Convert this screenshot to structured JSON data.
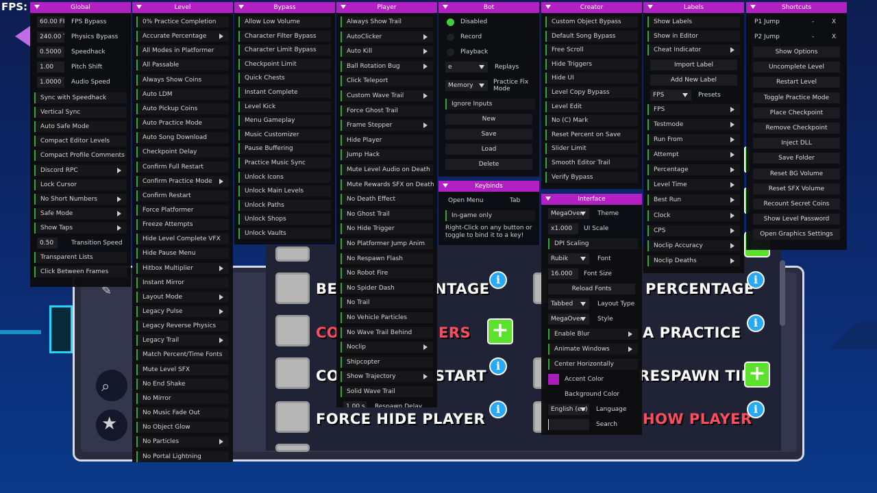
{
  "overlay": {
    "fps_label": "FPS:"
  },
  "game": {
    "rows": [
      {
        "left": "BE",
        "right": "NTAGE",
        "left_red": false,
        "right_red": false,
        "left_icon": "info",
        "right_text": "PERCENTAGE",
        "right_red2": false,
        "right_icon": "info"
      },
      {
        "left": "CO",
        "right": "ERS",
        "left_red": true,
        "right_red": true,
        "left_icon": "plus",
        "right_text": "A PRACTICE",
        "right_red2": false,
        "right_icon": "info"
      },
      {
        "left": "CO",
        "right": "START",
        "left_red": false,
        "right_red": false,
        "left_icon": "info",
        "right_text": "RESPAWN TIME",
        "right_red2": false,
        "right_icon": "plus"
      },
      {
        "left": "FORCE HIDE PLAYER",
        "right": "",
        "left_red": false,
        "right_red": false,
        "left_icon": "info",
        "right_text": "HOW PLAYER",
        "right_red2": true,
        "right_icon": "info"
      }
    ],
    "top_right_text": "...",
    "search_icon": "search-icon",
    "star_icon": "star-icon"
  },
  "panels": {
    "global": {
      "title": "Global",
      "inputs": [
        {
          "value": "60.00 FPS",
          "label": "FPS Bypass"
        },
        {
          "value": "240.00 TPS",
          "label": "Physics Bypass"
        },
        {
          "value": "0.5000",
          "label": "Speedhack"
        },
        {
          "value": "1.00",
          "label": "Pitch Shift"
        },
        {
          "value": "1.0000",
          "label": "Audio Speed"
        }
      ],
      "mods": [
        {
          "label": "Sync with Speedhack",
          "sub": false
        },
        {
          "label": "Vertical Sync",
          "sub": false
        },
        {
          "label": "Auto Safe Mode",
          "sub": false
        },
        {
          "label": "Compact Editor Levels",
          "sub": false
        },
        {
          "label": "Compact Profile Comments",
          "sub": false
        },
        {
          "label": "Discord RPC",
          "sub": true
        },
        {
          "label": "Lock Cursor",
          "sub": false
        },
        {
          "label": "No Short Numbers",
          "sub": true
        },
        {
          "label": "Safe Mode",
          "sub": true
        },
        {
          "label": "Show Taps",
          "sub": true
        }
      ],
      "transition": {
        "value": "0.50",
        "label": "Transition Speed"
      },
      "mods2": [
        {
          "label": "Transparent Lists",
          "sub": false
        },
        {
          "label": "Click Between Frames",
          "sub": false
        }
      ]
    },
    "level": {
      "title": "Level",
      "mods": [
        {
          "label": "0% Practice Completion",
          "sub": false
        },
        {
          "label": "Accurate Percentage",
          "sub": true
        },
        {
          "label": "All Modes in Platformer",
          "sub": false
        },
        {
          "label": "All Passable",
          "sub": false
        },
        {
          "label": "Always Show Coins",
          "sub": false
        },
        {
          "label": "Auto LDM",
          "sub": false
        },
        {
          "label": "Auto Pickup Coins",
          "sub": false
        },
        {
          "label": "Auto Practice Mode",
          "sub": false
        },
        {
          "label": "Auto Song Download",
          "sub": false
        },
        {
          "label": "Checkpoint Delay",
          "sub": false
        },
        {
          "label": "Confirm Full Restart",
          "sub": false
        },
        {
          "label": "Confirm Practice Mode",
          "sub": true
        },
        {
          "label": "Confirm Restart",
          "sub": false
        },
        {
          "label": "Force Platformer",
          "sub": false
        },
        {
          "label": "Freeze Attempts",
          "sub": false
        },
        {
          "label": "Hide Level Complete VFX",
          "sub": false
        },
        {
          "label": "Hide Pause Menu",
          "sub": false
        },
        {
          "label": "Hitbox Multiplier",
          "sub": true
        },
        {
          "label": "Instant Mirror",
          "sub": false
        },
        {
          "label": "Layout Mode",
          "sub": true
        },
        {
          "label": "Legacy Pulse",
          "sub": true
        },
        {
          "label": "Legacy Reverse Physics",
          "sub": false
        },
        {
          "label": "Legacy Trail",
          "sub": true
        },
        {
          "label": "Match Percent/Time Fonts",
          "sub": false
        },
        {
          "label": "Mute Level SFX",
          "sub": false
        },
        {
          "label": "No End Shake",
          "sub": false
        },
        {
          "label": "No Mirror",
          "sub": false
        },
        {
          "label": "No Music Fade Out",
          "sub": false
        },
        {
          "label": "No Object Glow",
          "sub": false
        },
        {
          "label": "No Particles",
          "sub": true
        },
        {
          "label": "No Portal Lightning",
          "sub": false
        }
      ]
    },
    "bypass": {
      "title": "Bypass",
      "mods": [
        {
          "label": "Allow Low Volume",
          "sub": false
        },
        {
          "label": "Character Filter Bypass",
          "sub": false
        },
        {
          "label": "Character Limit Bypass",
          "sub": false
        },
        {
          "label": "Checkpoint Limit",
          "sub": false
        },
        {
          "label": "Quick Chests",
          "sub": false
        },
        {
          "label": "Instant Complete",
          "sub": false
        },
        {
          "label": "Level Kick",
          "sub": false
        },
        {
          "label": "Menu Gameplay",
          "sub": false
        },
        {
          "label": "Music Customizer",
          "sub": false
        },
        {
          "label": "Pause Buffering",
          "sub": false
        },
        {
          "label": "Practice Music Sync",
          "sub": false
        },
        {
          "label": "Unlock Icons",
          "sub": false
        },
        {
          "label": "Unlock Main Levels",
          "sub": false
        },
        {
          "label": "Unlock Paths",
          "sub": false
        },
        {
          "label": "Unlock Shops",
          "sub": false
        },
        {
          "label": "Unlock Vaults",
          "sub": false
        }
      ]
    },
    "player": {
      "title": "Player",
      "mods": [
        {
          "label": "Always Show Trail",
          "sub": false
        },
        {
          "label": "AutoClicker",
          "sub": true
        },
        {
          "label": "Auto Kill",
          "sub": true
        },
        {
          "label": "Ball Rotation Bug",
          "sub": true
        },
        {
          "label": "Click Teleport",
          "sub": false
        },
        {
          "label": "Custom Wave Trail",
          "sub": true
        },
        {
          "label": "Force Ghost Trail",
          "sub": false
        },
        {
          "label": "Frame Stepper",
          "sub": true
        },
        {
          "label": "Hide Player",
          "sub": false
        },
        {
          "label": "Jump Hack",
          "sub": false
        },
        {
          "label": "Mute Level Audio on Death",
          "sub": false
        },
        {
          "label": "Mute Rewards SFX on Death",
          "sub": false
        },
        {
          "label": "No Death Effect",
          "sub": false
        },
        {
          "label": "No Ghost Trail",
          "sub": false
        },
        {
          "label": "No Hide Trigger",
          "sub": false
        },
        {
          "label": "No Platformer Jump Anim",
          "sub": false
        },
        {
          "label": "No Respawn Flash",
          "sub": false
        },
        {
          "label": "No Robot Fire",
          "sub": false
        },
        {
          "label": "No Spider Dash",
          "sub": false
        },
        {
          "label": "No Trail",
          "sub": false
        },
        {
          "label": "No Vehicle Particles",
          "sub": false
        },
        {
          "label": "No Wave Trail Behind",
          "sub": false
        },
        {
          "label": "Noclip",
          "sub": true
        },
        {
          "label": "Shipcopter",
          "sub": false
        },
        {
          "label": "Show Trajectory",
          "sub": true
        },
        {
          "label": "Solid Wave Trail",
          "sub": false
        }
      ],
      "respawn": {
        "value": "1.00 s.",
        "label": "Respawn Delay"
      }
    },
    "bot": {
      "title": "Bot",
      "radios": [
        {
          "label": "Disabled",
          "on": true
        },
        {
          "label": "Record",
          "on": false
        },
        {
          "label": "Playback",
          "on": false
        }
      ],
      "replays": {
        "value": "e",
        "label": "Replays"
      },
      "fix": {
        "value": "Memory",
        "label": "Practice Fix Mode"
      },
      "ignore": "Ignore Inputs",
      "buttons": [
        "New",
        "Save",
        "Load",
        "Delete"
      ]
    },
    "keybinds": {
      "title": "Keybinds",
      "open_menu": "Open Menu",
      "open_key": "Tab",
      "ingame": "In-game only",
      "hint": "Right-Click on any button or toggle to bind it to a key!"
    },
    "creator": {
      "title": "Creator",
      "mods": [
        {
          "label": "Custom Object Bypass",
          "sub": false
        },
        {
          "label": "Default Song Bypass",
          "sub": false
        },
        {
          "label": "Free Scroll",
          "sub": false
        },
        {
          "label": "Hide Triggers",
          "sub": false
        },
        {
          "label": "Hide UI",
          "sub": false
        },
        {
          "label": "Level Copy Bypass",
          "sub": false
        },
        {
          "label": "Level Edit",
          "sub": false
        },
        {
          "label": "No (C) Mark",
          "sub": false
        },
        {
          "label": "Reset Percent on Save",
          "sub": false
        },
        {
          "label": "Slider Limit",
          "sub": false
        },
        {
          "label": "Smooth Editor Trail",
          "sub": false
        },
        {
          "label": "Verify Bypass",
          "sub": false
        }
      ]
    },
    "interface": {
      "title": "Interface",
      "theme": {
        "value": "MegaOver",
        "label": "Theme"
      },
      "scale": {
        "value": "x1.000",
        "label": "UI Scale"
      },
      "dpi": "DPI Scaling",
      "font": {
        "value": "Rubik",
        "label": "Font"
      },
      "fontsize": {
        "value": "16.000",
        "label": "Font Size"
      },
      "reload": "Reload Fonts",
      "layout": {
        "value": "Tabbed",
        "label": "Layout Type"
      },
      "style": {
        "value": "MegaOver",
        "label": "Style"
      },
      "blur": "Enable Blur",
      "animate": "Animate Windows",
      "center": "Center Horizontally",
      "accent": "Accent Color",
      "background": "Background Color",
      "language": {
        "value": "English (en)",
        "label": "Language"
      },
      "search": {
        "value": "",
        "label": "Search"
      }
    },
    "labels": {
      "title": "Labels",
      "mods": [
        {
          "label": "Show Labels",
          "sub": false
        },
        {
          "label": "Show in Editor",
          "sub": false
        },
        {
          "label": "Cheat Indicator",
          "sub": true
        }
      ],
      "import": "Import Label",
      "add": "Add New Label",
      "presets": {
        "value": "FPS",
        "label": "Presets"
      },
      "mods2": [
        {
          "label": "FPS",
          "sub": true
        },
        {
          "label": "Testmode",
          "sub": true
        },
        {
          "label": "Run From",
          "sub": true
        },
        {
          "label": "Attempt",
          "sub": true
        },
        {
          "label": "Percentage",
          "sub": true
        },
        {
          "label": "Level Time",
          "sub": true
        },
        {
          "label": "Best Run",
          "sub": true
        },
        {
          "label": "Clock",
          "sub": true
        },
        {
          "label": "CPS",
          "sub": true
        },
        {
          "label": "Noclip Accuracy",
          "sub": true
        },
        {
          "label": "Noclip Deaths",
          "sub": true
        }
      ]
    },
    "shortcuts": {
      "title": "Shortcuts",
      "keys": [
        {
          "label": "P1 Jump",
          "dash": "-",
          "x": "X"
        },
        {
          "label": "P2 Jump",
          "dash": "-",
          "x": "X"
        }
      ],
      "buttons": [
        "Show Options",
        "Uncomplete Level",
        "Restart Level",
        "Toggle Practice Mode",
        "Place Checkpoint",
        "Remove Checkpoint",
        "Inject DLL",
        "Save Folder",
        "Reset BG Volume",
        "Reset SFX Volume",
        "Recount Secret Coins",
        "Show Level Password",
        "Open Graphics Settings"
      ]
    }
  },
  "colors": {
    "accent": "#b21fc2",
    "toggle_on": "#2fa83a",
    "panel_bg": "#0e0e10"
  }
}
